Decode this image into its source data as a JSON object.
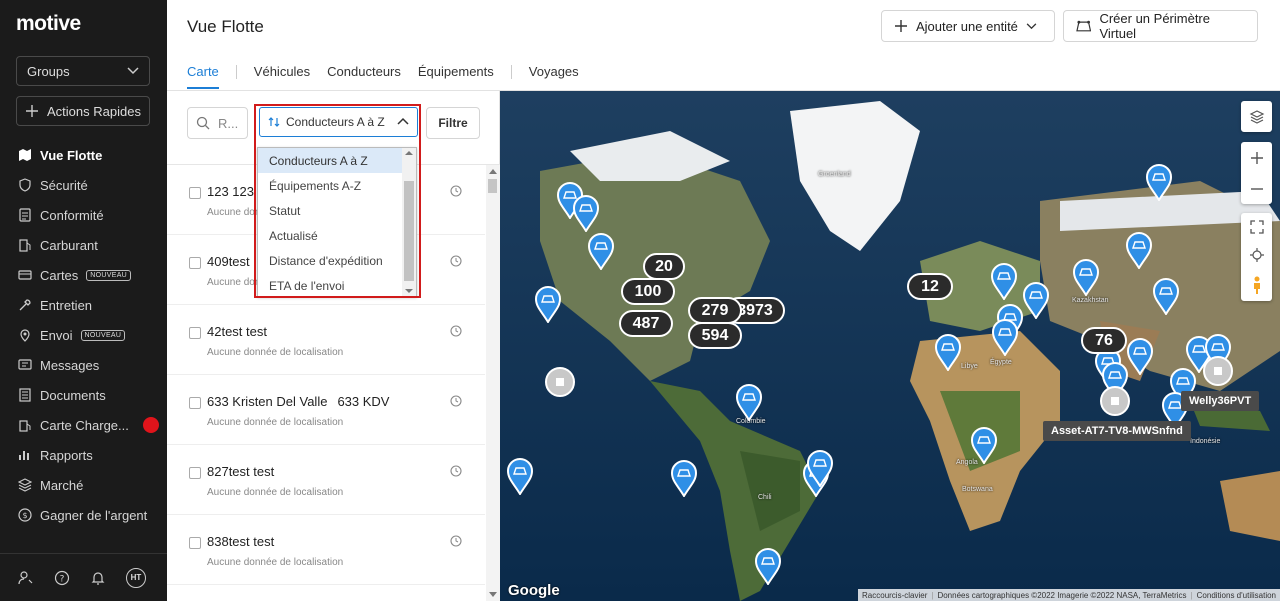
{
  "brand": {
    "logo_text": "motive"
  },
  "sidebar": {
    "groups_label": "Groups",
    "quick_actions_label": "Actions Rapides",
    "items": [
      {
        "label": "Vue Flotte",
        "icon": "map-icon",
        "active": true
      },
      {
        "label": "Sécurité",
        "icon": "shield-icon"
      },
      {
        "label": "Conformité",
        "icon": "document-icon"
      },
      {
        "label": "Carburant",
        "icon": "fuel-icon"
      },
      {
        "label": "Cartes",
        "icon": "card-icon",
        "badge": "NOUVEAU"
      },
      {
        "label": "Entretien",
        "icon": "wrench-icon"
      },
      {
        "label": "Envoi",
        "icon": "location-icon",
        "badge": "NOUVEAU"
      },
      {
        "label": "Messages",
        "icon": "message-icon"
      },
      {
        "label": "Documents",
        "icon": "documents-icon"
      },
      {
        "label": "Carte Charge...",
        "icon": "fuel-card-icon",
        "alert": true
      },
      {
        "label": "Rapports",
        "icon": "reports-icon"
      },
      {
        "label": "Marché",
        "icon": "marketplace-icon"
      },
      {
        "label": "Gagner de l'argent",
        "icon": "dollar-icon"
      }
    ],
    "footer": {
      "avatar_initials": "HT"
    },
    "alert_color": "#e1141b"
  },
  "header": {
    "title": "Vue Flotte",
    "add_entity_label": "Ajouter une entité",
    "geofence_label": "Créer un Périmètre Virtuel",
    "tabs": [
      {
        "label": "Carte",
        "active": true
      },
      {
        "label": "Véhicules"
      },
      {
        "label": "Conducteurs"
      },
      {
        "label": "Équipements"
      },
      {
        "label": "Voyages"
      }
    ],
    "accent_color": "#1c7ed6"
  },
  "list_panel": {
    "search_placeholder": "R...",
    "sort_value": "Conducteurs A à Z",
    "filter_label": "Filtre",
    "sort_options": [
      {
        "label": "Conducteurs A à Z",
        "selected": true
      },
      {
        "label": "Équipements A-Z"
      },
      {
        "label": "Statut"
      },
      {
        "label": "Actualisé"
      },
      {
        "label": "Distance d'expédition"
      },
      {
        "label": "ETA de l'envoi"
      }
    ],
    "rows": [
      {
        "name": "123 123",
        "plate": "",
        "sub": "Aucune donnée de localisation"
      },
      {
        "name": "409test",
        "plate": "",
        "sub": "Aucune donnée de localisation"
      },
      {
        "name": "42test test",
        "plate": "",
        "sub": "Aucune donnée de localisation"
      },
      {
        "name": "633 Kristen Del Valle",
        "plate": "633 KDV",
        "sub": "Aucune donnée de localisation"
      },
      {
        "name": "827test test",
        "plate": "",
        "sub": "Aucune donnée de localisation"
      },
      {
        "name": "838test test",
        "plate": "",
        "sub": "Aucune donnée de localisation"
      }
    ],
    "highlight_color": "#d11b1b"
  },
  "map": {
    "labels": [
      {
        "text": "Groenland"
      },
      {
        "text": "Kazakhstan"
      },
      {
        "text": "Libye"
      },
      {
        "text": "Égypte"
      },
      {
        "text": "Colombie"
      },
      {
        "text": "Angola"
      },
      {
        "text": "Botswana"
      },
      {
        "text": "Chili"
      },
      {
        "text": "Indonésie"
      }
    ],
    "clusters": [
      "20",
      "100",
      "487",
      "279",
      "594",
      "3973",
      "12",
      "76"
    ],
    "tooltips": [
      "Welly36PVT",
      "Asset-AT7-TV8-MWSnfnd"
    ],
    "google_text": "Google",
    "attribution": [
      "Raccourcis-clavier",
      "Données cartographiques ©2022 Imagerie ©2022 NASA, TerraMetrics",
      "Conditions d'utilisation"
    ],
    "pin_color": "#2f8fe6"
  }
}
